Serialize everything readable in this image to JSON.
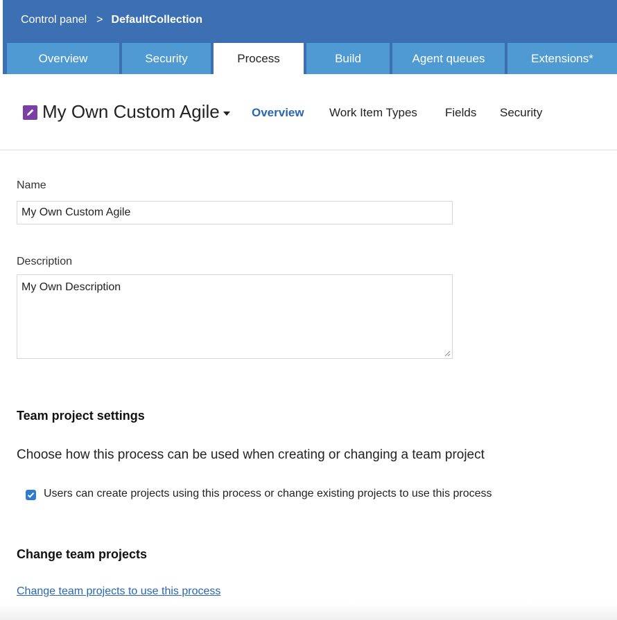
{
  "header": {
    "breadcrumb_root": "Control panel",
    "breadcrumb_separator": ">",
    "breadcrumb_current": "DefaultCollection",
    "tabs": [
      {
        "label": "Overview"
      },
      {
        "label": "Security"
      },
      {
        "label": "Process"
      },
      {
        "label": "Build"
      },
      {
        "label": "Agent queues"
      },
      {
        "label": "Extensions*"
      }
    ],
    "active_tab": "Process"
  },
  "process": {
    "title": "My Own Custom Agile",
    "icon": "pencil-icon",
    "nav": [
      {
        "label": "Overview"
      },
      {
        "label": "Work Item Types"
      },
      {
        "label": "Fields"
      },
      {
        "label": "Security"
      }
    ],
    "active_nav": "Overview"
  },
  "form": {
    "name_label": "Name",
    "name_value": "My Own Custom Agile",
    "description_label": "Description",
    "description_value": "My Own Description"
  },
  "team_project_settings": {
    "heading": "Team project settings",
    "description": "Choose how this process can be used when creating or changing a team project",
    "checkbox_label": "Users can create projects using this process or change existing projects to use this process",
    "checkbox_checked": true
  },
  "change_team_projects": {
    "heading": "Change team projects",
    "link_label": "Change team projects to use this process"
  },
  "colors": {
    "header_bg": "#3d70b2",
    "tab_bg": "#4f9ad3",
    "accent": "#2767b1",
    "icon_purple": "#7b3fa6"
  }
}
